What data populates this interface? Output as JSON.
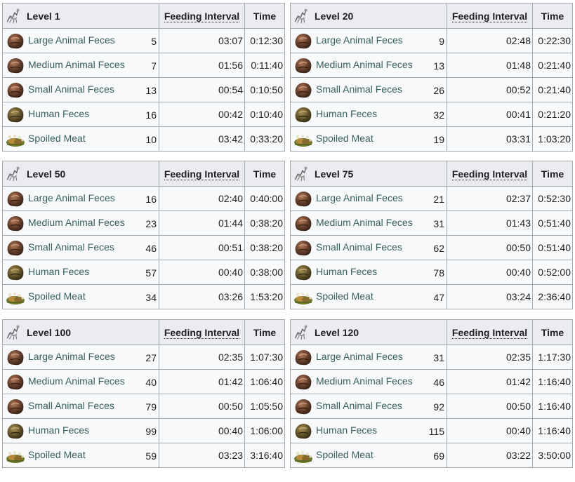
{
  "headers": {
    "interval": "Feeding Interval",
    "time": "Time"
  },
  "icons": {
    "feces": "feces-icon",
    "human": "human-feces-icon",
    "meat": "spoiled-meat-icon",
    "creature": "dung-beetle-icon"
  },
  "colors": {
    "link": "#36605a",
    "header_bg": "#eaecf0",
    "cell_bg": "#f8f9fa",
    "border": "#a2a9b1"
  },
  "tables": [
    {
      "level": "Level 1",
      "rows": [
        {
          "name": "Large Animal Feces",
          "qty": "5",
          "interval": "03:07",
          "time": "0:12:30"
        },
        {
          "name": "Medium Animal Feces",
          "qty": "7",
          "interval": "01:56",
          "time": "0:11:40"
        },
        {
          "name": "Small Animal Feces",
          "qty": "13",
          "interval": "00:54",
          "time": "0:10:50"
        },
        {
          "name": "Human Feces",
          "qty": "16",
          "interval": "00:42",
          "time": "0:10:40"
        },
        {
          "name": "Spoiled Meat",
          "qty": "10",
          "interval": "03:42",
          "time": "0:33:20"
        }
      ]
    },
    {
      "level": "Level 20",
      "rows": [
        {
          "name": "Large Animal Feces",
          "qty": "9",
          "interval": "02:48",
          "time": "0:22:30"
        },
        {
          "name": "Medium Animal Feces",
          "qty": "13",
          "interval": "01:48",
          "time": "0:21:40"
        },
        {
          "name": "Small Animal Feces",
          "qty": "26",
          "interval": "00:52",
          "time": "0:21:40"
        },
        {
          "name": "Human Feces",
          "qty": "32",
          "interval": "00:41",
          "time": "0:21:20"
        },
        {
          "name": "Spoiled Meat",
          "qty": "19",
          "interval": "03:31",
          "time": "1:03:20"
        }
      ]
    },
    {
      "level": "Level 50",
      "rows": [
        {
          "name": "Large Animal Feces",
          "qty": "16",
          "interval": "02:40",
          "time": "0:40:00"
        },
        {
          "name": "Medium Animal Feces",
          "qty": "23",
          "interval": "01:44",
          "time": "0:38:20"
        },
        {
          "name": "Small Animal Feces",
          "qty": "46",
          "interval": "00:51",
          "time": "0:38:20"
        },
        {
          "name": "Human Feces",
          "qty": "57",
          "interval": "00:40",
          "time": "0:38:00"
        },
        {
          "name": "Spoiled Meat",
          "qty": "34",
          "interval": "03:26",
          "time": "1:53:20"
        }
      ]
    },
    {
      "level": "Level 75",
      "rows": [
        {
          "name": "Large Animal Feces",
          "qty": "21",
          "interval": "02:37",
          "time": "0:52:30"
        },
        {
          "name": "Medium Animal Feces",
          "qty": "31",
          "interval": "01:43",
          "time": "0:51:40"
        },
        {
          "name": "Small Animal Feces",
          "qty": "62",
          "interval": "00:50",
          "time": "0:51:40"
        },
        {
          "name": "Human Feces",
          "qty": "78",
          "interval": "00:40",
          "time": "0:52:00"
        },
        {
          "name": "Spoiled Meat",
          "qty": "47",
          "interval": "03:24",
          "time": "2:36:40"
        }
      ]
    },
    {
      "level": "Level 100",
      "rows": [
        {
          "name": "Large Animal Feces",
          "qty": "27",
          "interval": "02:35",
          "time": "1:07:30"
        },
        {
          "name": "Medium Animal Feces",
          "qty": "40",
          "interval": "01:42",
          "time": "1:06:40"
        },
        {
          "name": "Small Animal Feces",
          "qty": "79",
          "interval": "00:50",
          "time": "1:05:50"
        },
        {
          "name": "Human Feces",
          "qty": "99",
          "interval": "00:40",
          "time": "1:06:00"
        },
        {
          "name": "Spoiled Meat",
          "qty": "59",
          "interval": "03:23",
          "time": "3:16:40"
        }
      ]
    },
    {
      "level": "Level 120",
      "rows": [
        {
          "name": "Large Animal Feces",
          "qty": "31",
          "interval": "02:35",
          "time": "1:17:30"
        },
        {
          "name": "Medium Animal Feces",
          "qty": "46",
          "interval": "01:42",
          "time": "1:16:40"
        },
        {
          "name": "Small Animal Feces",
          "qty": "92",
          "interval": "00:50",
          "time": "1:16:40"
        },
        {
          "name": "Human Feces",
          "qty": "115",
          "interval": "00:40",
          "time": "1:16:40"
        },
        {
          "name": "Spoiled Meat",
          "qty": "69",
          "interval": "03:22",
          "time": "3:50:00"
        }
      ]
    }
  ]
}
